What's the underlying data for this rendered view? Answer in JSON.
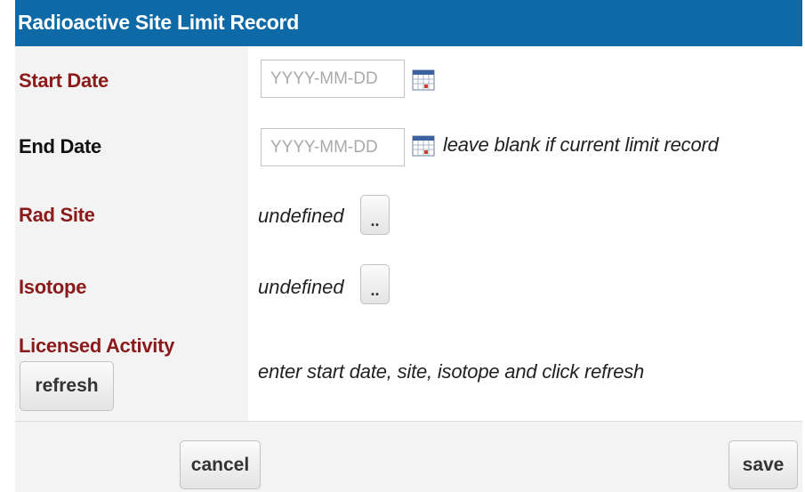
{
  "dialog": {
    "title": "Radioactive Site Limit Record"
  },
  "start_date": {
    "label": "Start Date",
    "placeholder": "YYYY-MM-DD",
    "value": "",
    "calendar_icon": "calendar-icon"
  },
  "end_date": {
    "label": "End Date",
    "placeholder": "YYYY-MM-DD",
    "value": "",
    "calendar_icon": "calendar-icon",
    "hint": "leave blank if current limit record"
  },
  "rad_site": {
    "label": "Rad Site",
    "value": "undefined",
    "lookup_label": ".."
  },
  "isotope": {
    "label": "Isotope",
    "value": "undefined",
    "lookup_label": ".."
  },
  "licensed_activity": {
    "label": "Licensed Activity",
    "refresh_label": "refresh",
    "message": "enter start date, site, isotope and click refresh"
  },
  "actions": {
    "cancel_label": "cancel",
    "save_label": "save"
  },
  "colors": {
    "title_bar": "#0e6aa6",
    "required_label": "#8b1a1a",
    "optional_label": "#111111",
    "label_column_bg": "#f3f3f3"
  }
}
